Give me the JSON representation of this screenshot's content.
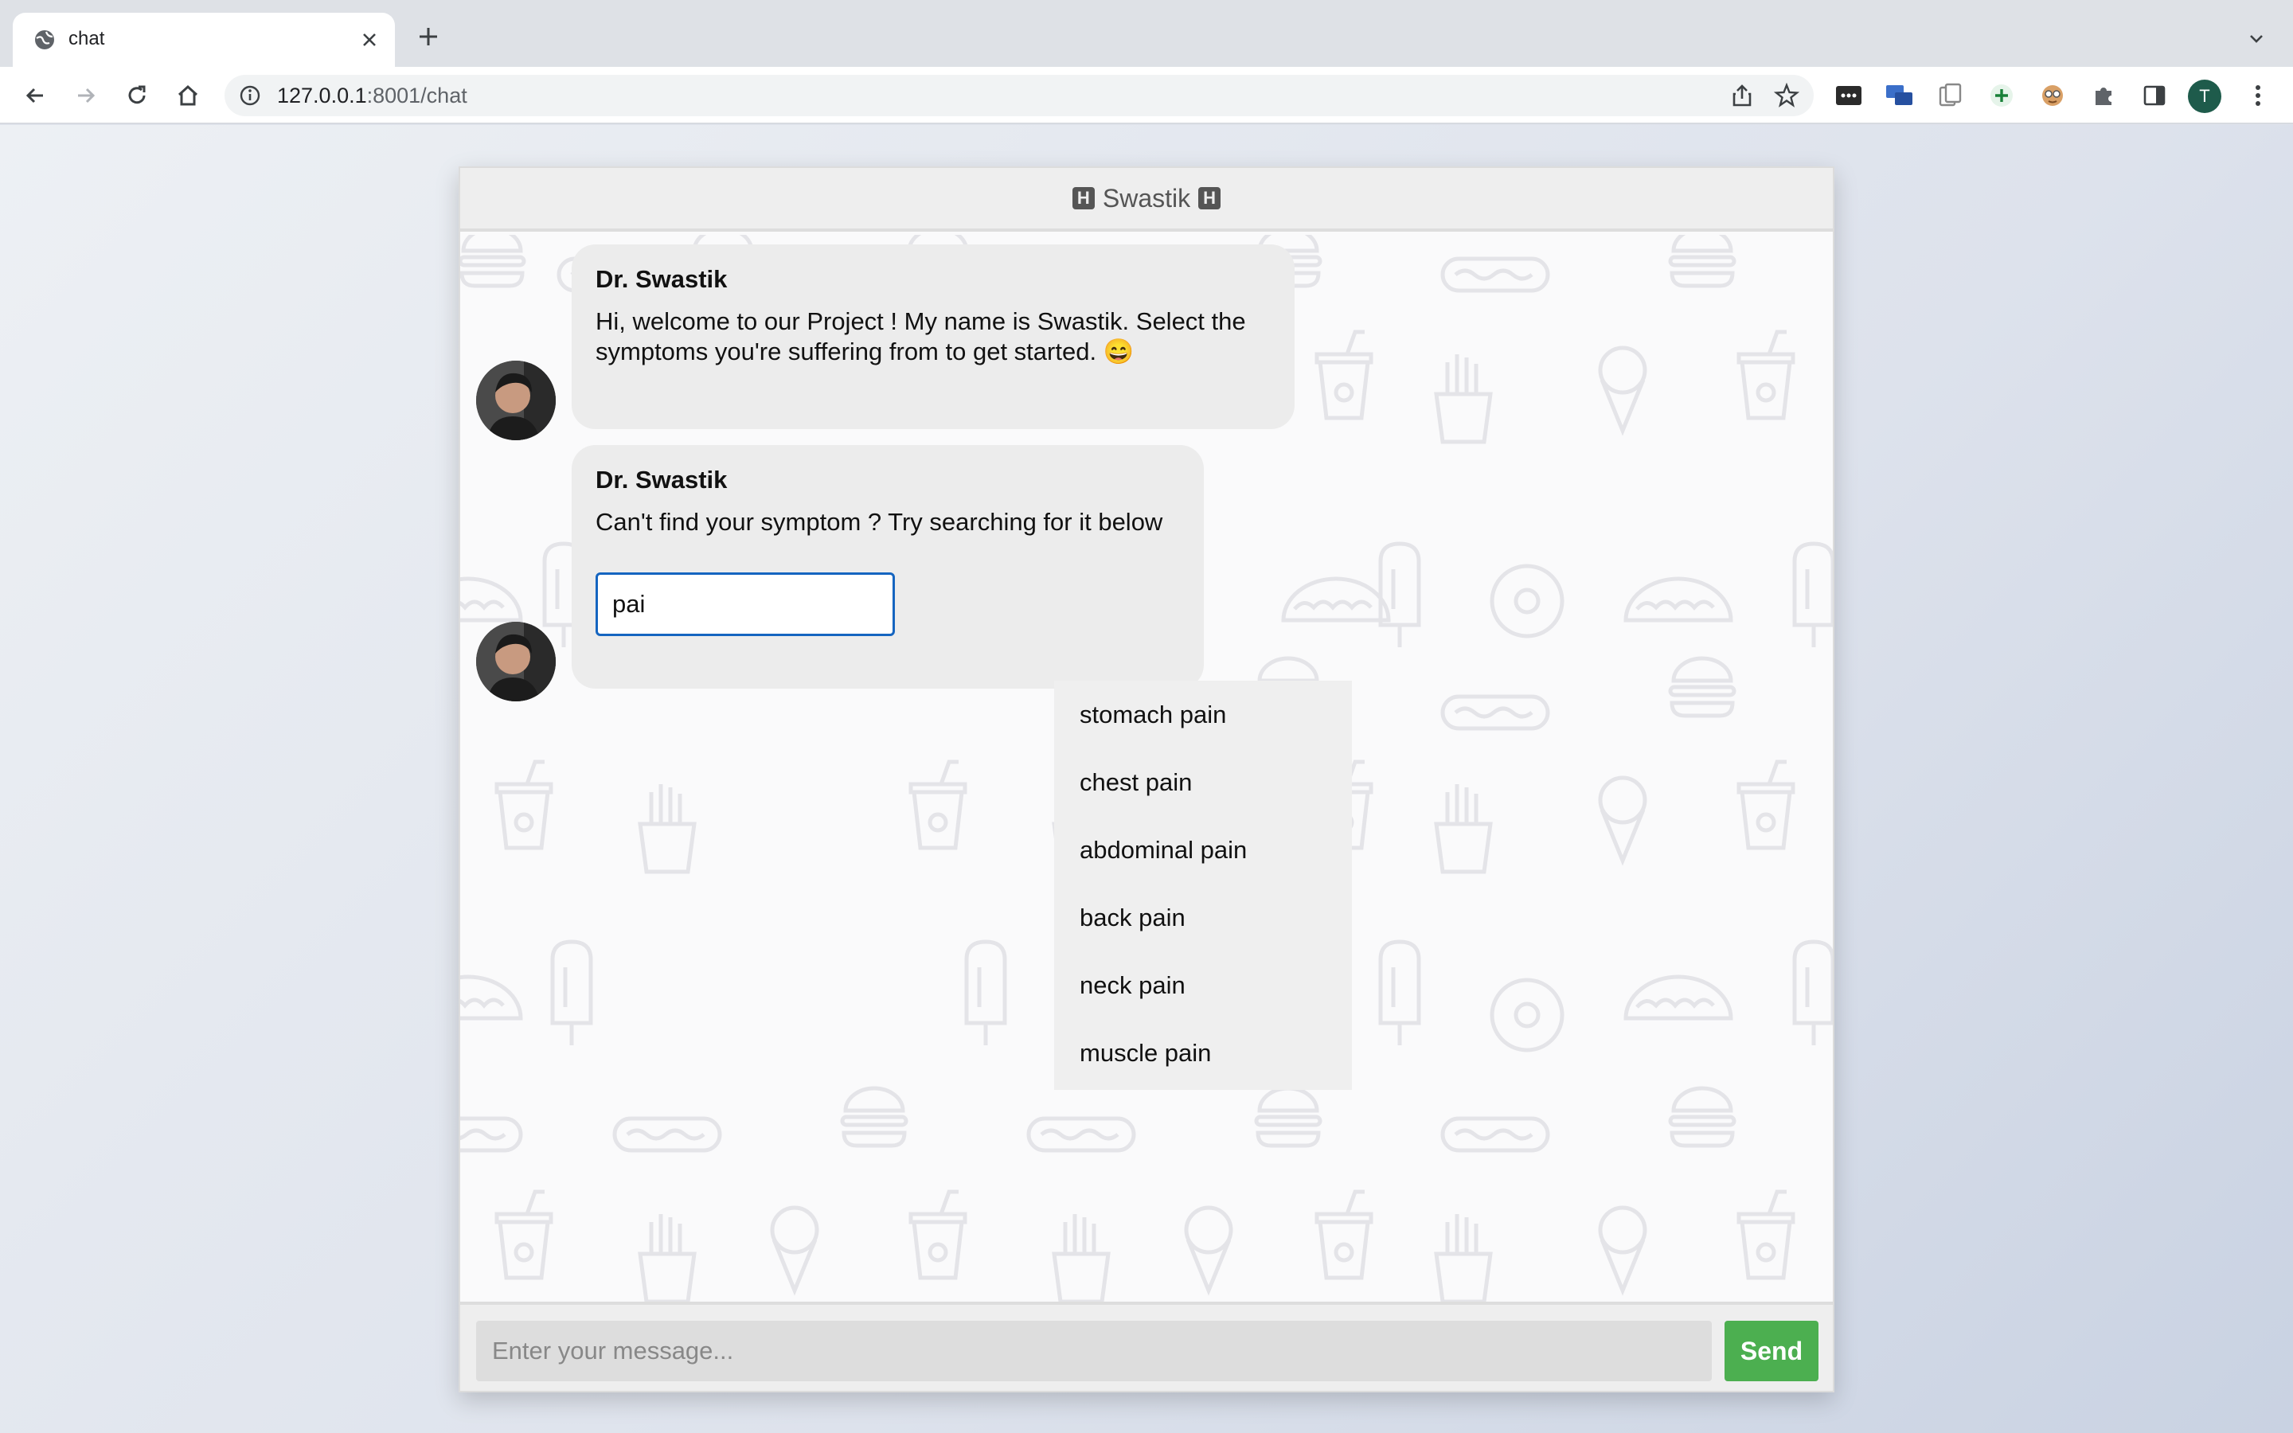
{
  "browser": {
    "tab_title": "chat",
    "url_host": "127.0.0.1",
    "url_rest": ":8001/chat",
    "profile_initial": "T"
  },
  "chat": {
    "header_title": "Swastik",
    "messages": [
      {
        "sender": "Dr. Swastik",
        "text": "Hi, welcome to our Project ! My name is Swastik. Select the symptoms you're suffering from to get started. 😄"
      },
      {
        "sender": "Dr. Swastik",
        "text": "Can't find your symptom ? Try searching for it below",
        "search_value": "pai"
      }
    ],
    "suggestions": [
      "stomach pain",
      "chest pain",
      "abdominal pain",
      "back pain",
      "neck pain",
      "muscle pain"
    ],
    "input_placeholder": "Enter your message...",
    "send_label": "Send"
  },
  "colors": {
    "send_button": "#4caf50",
    "search_focus_border": "#1565c0",
    "bubble": "#ececec"
  }
}
